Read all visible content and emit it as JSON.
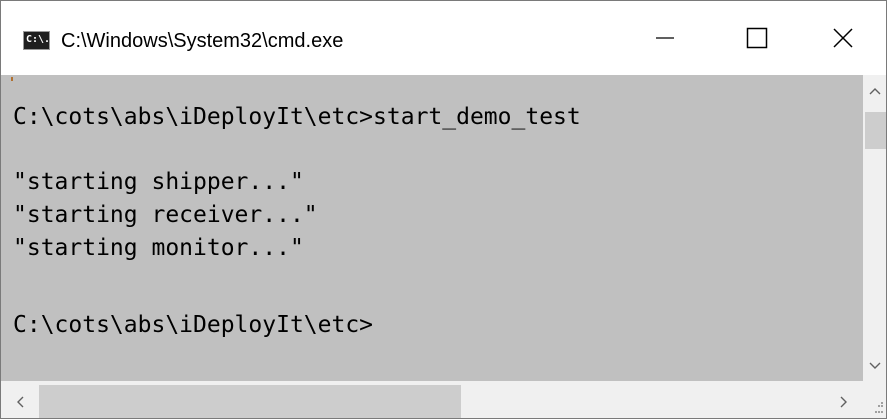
{
  "window": {
    "title": "C:\\Windows\\System32\\cmd.exe",
    "app_icon": "cmd-icon",
    "icon_glyph": "C:\\."
  },
  "titlebar_buttons": {
    "minimize_icon": "minimize-icon",
    "maximize_icon": "maximize-icon",
    "close_icon": "close-icon"
  },
  "console": {
    "background": "#c0c0c0",
    "text_color": "#000000",
    "lines": [
      "C:\\cots\\abs\\iDeployIt\\etc>start_demo_test",
      "\"starting shipper...\"",
      "\"starting receiver...\"",
      "\"starting monitor...\"",
      "C:\\cots\\abs\\iDeployIt\\etc>"
    ]
  },
  "scrollbars": {
    "vertical_up_icon": "chevron-up-icon",
    "vertical_down_icon": "chevron-down-icon",
    "horizontal_left_icon": "chevron-left-icon",
    "horizontal_right_icon": "chevron-right-icon"
  }
}
